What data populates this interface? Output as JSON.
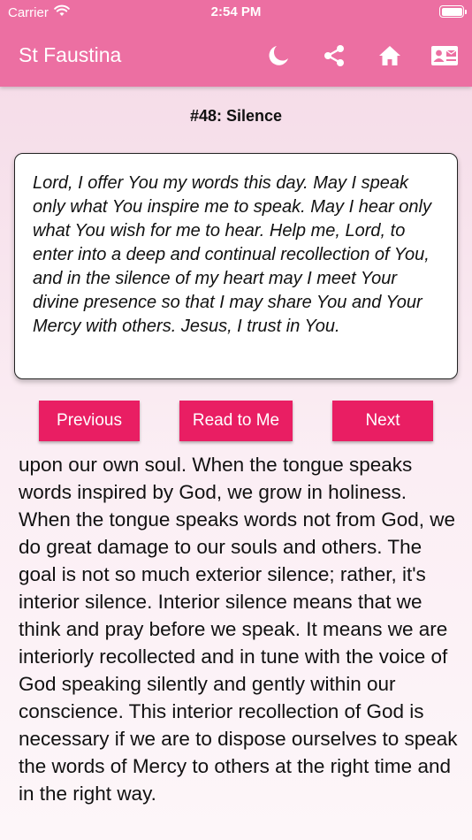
{
  "status_bar": {
    "carrier": "Carrier",
    "time": "2:54 PM"
  },
  "header": {
    "title": "St Faustina",
    "icons": [
      "moon-icon",
      "share-icon",
      "home-icon",
      "contact-card-icon"
    ]
  },
  "meditation": {
    "title": "#48: Silence",
    "prayer": "Lord, I offer You my words this day.  May I speak only what You inspire me to speak.  May I hear only what You wish for me to hear.  Help me, Lord, to enter into a deep and continual recollection of You, and in the silence of my heart may I meet Your divine presence so that I may share You and Your Mercy with others.  Jesus, I trust in You.",
    "body": "upon our own soul.  When the tongue speaks words inspired by God, we grow in holiness.  When the tongue speaks words not from God, we do great damage to our souls and others.  The goal is not so much exterior silence; rather, it's interior silence.  Interior silence means that we think and pray before we speak.  It means we are interiorly recollected and in tune with the voice of God speaking silently and gently within our conscience.  This interior recollection of God is necessary if we are to dispose ourselves to speak the words of Mercy to others at the right time and in the right way."
  },
  "controls": {
    "previous_label": "Previous",
    "read_label": "Read to Me",
    "next_label": "Next"
  },
  "colors": {
    "header": "#ec6fa2",
    "button": "#e91e63"
  }
}
